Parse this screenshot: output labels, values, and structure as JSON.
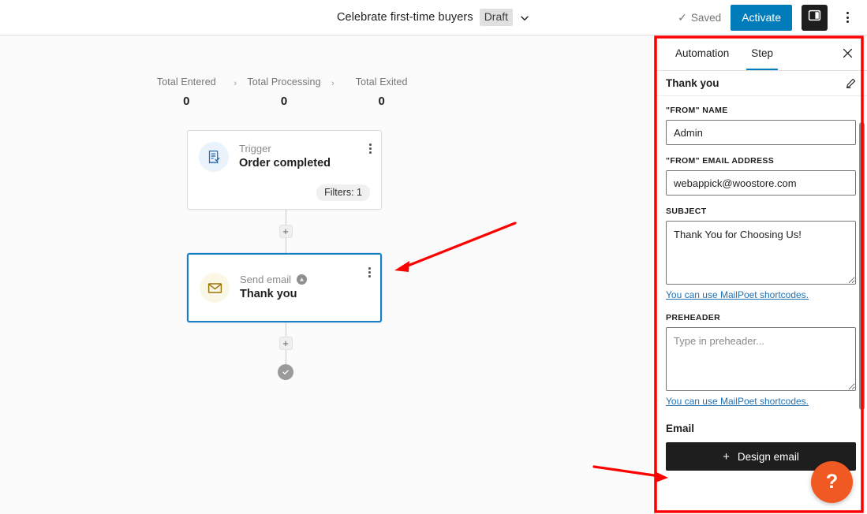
{
  "topbar": {
    "title": "Celebrate first-time buyers",
    "status_badge": "Draft",
    "chevron_icon": "chevron-down-icon",
    "saved_label": "Saved",
    "saved_check_glyph": "✓",
    "activate_label": "Activate",
    "sidebar_toggle_icon": "sidebar-panel-icon",
    "more_menu_icon": "kebab-menu-icon"
  },
  "stats": [
    {
      "label": "Total Entered",
      "value": "0"
    },
    {
      "label": "Total Processing",
      "value": "0"
    },
    {
      "label": "Total Exited",
      "value": "0"
    }
  ],
  "stat_separator": "›",
  "flow": {
    "trigger_card": {
      "kicker": "Trigger",
      "title": "Order completed",
      "icon": "receipt-check-icon",
      "badge": "Filters: 1",
      "menu_icon": "kebab-menu-icon"
    },
    "email_card": {
      "kicker": "Send email",
      "title": "Thank you",
      "icon": "envelope-icon",
      "alert_icon": "alert-triangle-icon",
      "menu_icon": "kebab-menu-icon",
      "selected": true
    },
    "add_step_icon": "plus-icon",
    "end_node_icon": "check-circle-icon"
  },
  "panel": {
    "tabs": [
      {
        "label": "Automation",
        "active": false
      },
      {
        "label": "Step",
        "active": true
      }
    ],
    "close_icon": "close-icon",
    "step_name": "Thank you",
    "edit_icon": "pencil-icon",
    "fields": {
      "from_name": {
        "label": "\"FROM\" NAME",
        "value": "Admin",
        "placeholder": ""
      },
      "from_email": {
        "label": "\"FROM\" EMAIL ADDRESS",
        "value": "webappick@woostore.com",
        "placeholder": ""
      },
      "subject": {
        "label": "SUBJECT",
        "value": "Thank You for Choosing Us!",
        "placeholder": "",
        "help_link": "You can use MailPoet shortcodes."
      },
      "preheader": {
        "label": "PREHEADER",
        "value": "",
        "placeholder": "Type in preheader...",
        "help_link": "You can use MailPoet shortcodes."
      }
    },
    "email_section": {
      "title": "Email",
      "design_button_label": "Design email",
      "design_button_icon": "plus-icon"
    },
    "scrollbar": "vertical-scrollbar"
  },
  "help_fab": {
    "glyph": "?",
    "name": "help-button"
  },
  "annotations": {
    "highlight_color": "#ff0000",
    "arrow_to_step_card": "arrow-pointing-to-send-email-step",
    "arrow_to_design_email": "arrow-pointing-to-design-email-button",
    "panel_outline": "red-rectangle-around-step-settings-panel"
  },
  "colors": {
    "accent_blue": "#007cba",
    "selected_border": "#1a7ec2",
    "dark_button": "#1e1e1e",
    "help_orange": "#f05a22",
    "annotation_red": "#ff0000"
  }
}
